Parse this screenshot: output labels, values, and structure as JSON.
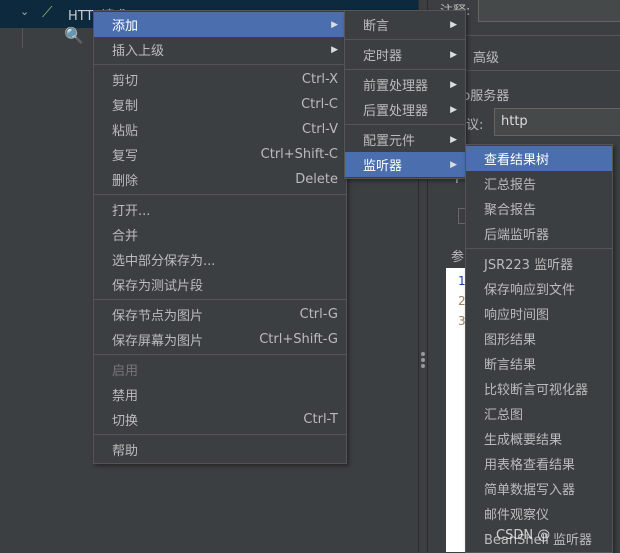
{
  "tree": {
    "node_label": "HTTP请求"
  },
  "right_panel": {
    "comment_label": "注释:",
    "advanced_tab": "高级",
    "web_server_label": "b服务器",
    "protocol_label": "议:",
    "protocol_value": "http",
    "tab_p": "P",
    "params_label": "参",
    "line_numbers": [
      "1",
      "2",
      "3"
    ]
  },
  "context_menu": {
    "items": [
      {
        "label": "添加",
        "submenu": true
      },
      {
        "label": "插入上级",
        "submenu": true
      },
      {
        "label": "剪切",
        "shortcut": "Ctrl-X"
      },
      {
        "label": "复制",
        "shortcut": "Ctrl-C"
      },
      {
        "label": "粘贴",
        "shortcut": "Ctrl-V"
      },
      {
        "label": "复写",
        "shortcut": "Ctrl+Shift-C"
      },
      {
        "label": "删除",
        "shortcut": "Delete"
      },
      {
        "label": "打开..."
      },
      {
        "label": "合并"
      },
      {
        "label": "选中部分保存为..."
      },
      {
        "label": "保存为测试片段"
      },
      {
        "label": "保存节点为图片",
        "shortcut": "Ctrl-G"
      },
      {
        "label": "保存屏幕为图片",
        "shortcut": "Ctrl+Shift-G"
      },
      {
        "label": "启用",
        "disabled": true
      },
      {
        "label": "禁用"
      },
      {
        "label": "切换",
        "shortcut": "Ctrl-T"
      },
      {
        "label": "帮助"
      }
    ]
  },
  "add_submenu": {
    "items": [
      {
        "label": "断言"
      },
      {
        "label": "定时器"
      },
      {
        "label": "前置处理器"
      },
      {
        "label": "后置处理器"
      },
      {
        "label": "配置元件"
      },
      {
        "label": "监听器",
        "highlighted": true
      }
    ]
  },
  "listener_submenu": {
    "items": [
      {
        "label": "查看结果树",
        "highlighted": true
      },
      {
        "label": "汇总报告"
      },
      {
        "label": "聚合报告"
      },
      {
        "label": "后端监听器"
      },
      {
        "label": "JSR223 监听器"
      },
      {
        "label": "保存响应到文件"
      },
      {
        "label": "响应时间图"
      },
      {
        "label": "图形结果"
      },
      {
        "label": "断言结果"
      },
      {
        "label": "比较断言可视化器"
      },
      {
        "label": "汇总图"
      },
      {
        "label": "生成概要结果"
      },
      {
        "label": "用表格查看结果"
      },
      {
        "label": "简单数据写入器"
      },
      {
        "label": "邮件观察仪"
      },
      {
        "label": "BeanShell 监听器"
      }
    ]
  },
  "watermark": "CSDN @",
  "colors": {
    "highlight": "#4b6eaf",
    "background": "#3c3f41",
    "tree_selected": "#0d293e"
  }
}
